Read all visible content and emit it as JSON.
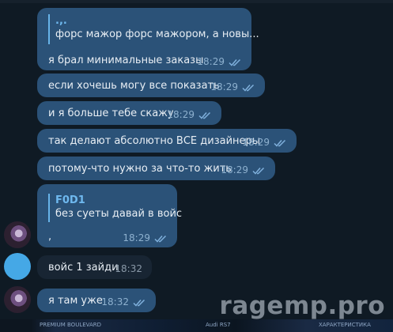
{
  "messages": [
    {
      "reply": {
        "name": ".,.",
        "text": "форс мажор форс мажором, а новы..."
      },
      "text": "я брал минимальные заказы",
      "time": "18:29"
    },
    {
      "text": "если хочешь могу все показать",
      "time": "18:29"
    },
    {
      "text": "и я больше тебе скажу",
      "time": "18:29"
    },
    {
      "text": "так делают абсолютно ВСЕ дизайнеры",
      "time": "18:29"
    },
    {
      "text": "потому-что нужно за что-то жить",
      "time": "18:29"
    },
    {
      "reply": {
        "name": "F0D1",
        "text": "без суеты давай в войс"
      },
      "text": ",",
      "time": "18:29"
    },
    {
      "text": "войс 1 зайди",
      "time": "18:32"
    },
    {
      "text": "я там уже",
      "time": "18:32"
    }
  ],
  "watermark": "ragemp.pro",
  "bottom_banner": {
    "left_text": "PREMIUM BOULEVARD",
    "mid_text": "Audi RS7",
    "right_text": "ХАРАКТЕРИСТИКА"
  },
  "colors": {
    "outgoing_bubble": "#2b5278",
    "incoming_bubble": "#182533",
    "background": "#0f1a24",
    "reply_accent": "#67b3e8"
  }
}
